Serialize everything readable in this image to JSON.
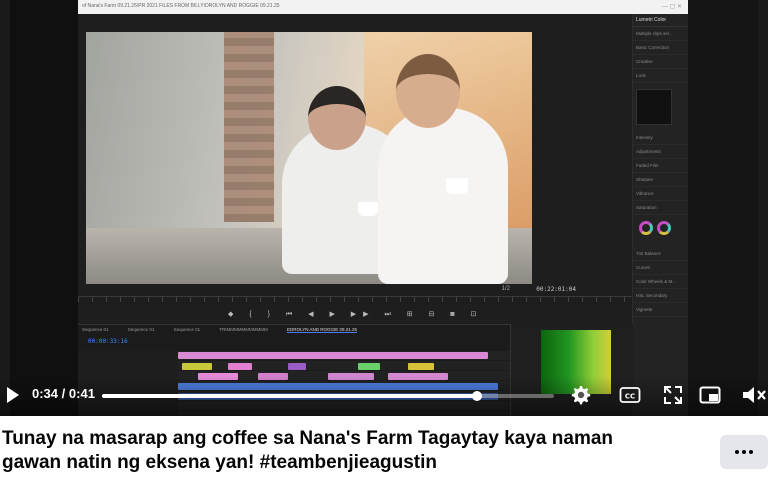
{
  "player": {
    "current_time": "0:34",
    "separator": "/",
    "duration": "0:41",
    "progress_fraction": 0.829
  },
  "editor": {
    "window_title": "of Nana's Farm 09.21.25\\PR 2021 FILES FROM BILLY\\DROLYN AND ROGGIE 09.21.25",
    "monitor_timecode": "00:22:01:04",
    "fit_label": "1/2",
    "timeline_timecode": "00:00:33:16",
    "sequence_tabs": [
      "Sequence 01",
      "Sequence 01",
      "Sequence 01",
      "TRIMMMMMMMMMMM",
      "EDROLYN AND ROGGIE 09.21.25"
    ],
    "panel_title": "Lumetri Color",
    "panel_rows": [
      "Multiple clips sel...",
      "Basic Correction",
      "Creative",
      "Look",
      "Intensity",
      "Adjustments",
      "Faded Film",
      "Sharpen",
      "Vibrance",
      "Saturation",
      "Tint Balance",
      "Curves",
      "Color Wheels & M...",
      "HSL Secondary",
      "Vignette"
    ]
  },
  "post": {
    "caption": "Tunay na masarap ang coffee sa Nana's Farm Tagaytay kaya naman gawan natin ng eksena yan! #teambenjieagustin"
  },
  "icons": {
    "play": "play-icon",
    "settings": "gear-icon",
    "captions": "closed-captions-icon",
    "fullscreen": "fullscreen-icon",
    "pip": "picture-in-picture-icon",
    "mute": "volume-muted-icon",
    "more": "more-options-icon"
  },
  "colors": {
    "accent_blue": "#3b8cff",
    "more_button_bg": "#e4e6eb"
  }
}
